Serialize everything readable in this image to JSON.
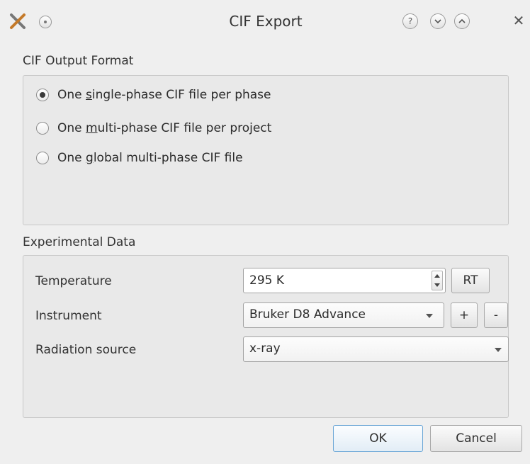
{
  "window": {
    "title": "CIF Export",
    "icons": [
      "app-x-icon",
      "sticky-icon",
      "help-icon",
      "minimize-icon",
      "maximize-icon",
      "close-icon"
    ],
    "help_glyph": "?",
    "close_glyph": "✕"
  },
  "output_format": {
    "label": "CIF Output Format",
    "options": [
      {
        "pre": "One ",
        "mnemonic": "s",
        "post": "ingle-phase CIF file per phase",
        "checked": true
      },
      {
        "pre": "One ",
        "mnemonic": "m",
        "post": "ulti-phase CIF file per project",
        "checked": false
      },
      {
        "pre": "One ",
        "mnemonic": "g",
        "post": "lobal multi-phase CIF file",
        "checked": false
      }
    ]
  },
  "experimental": {
    "label": "Experimental Data",
    "temperature": {
      "label": "Temperature",
      "value": "295 K",
      "rt_label": "RT"
    },
    "instrument": {
      "label": "Instrument",
      "value": "Bruker D8 Advance",
      "add_label": "+",
      "remove_label": "-"
    },
    "radiation": {
      "label": "Radiation source",
      "value": "x-ray"
    }
  },
  "buttons": {
    "ok": "OK",
    "cancel": "Cancel"
  },
  "colors": {
    "background": "#efefef",
    "default_button_border": "#6aa6d6"
  }
}
